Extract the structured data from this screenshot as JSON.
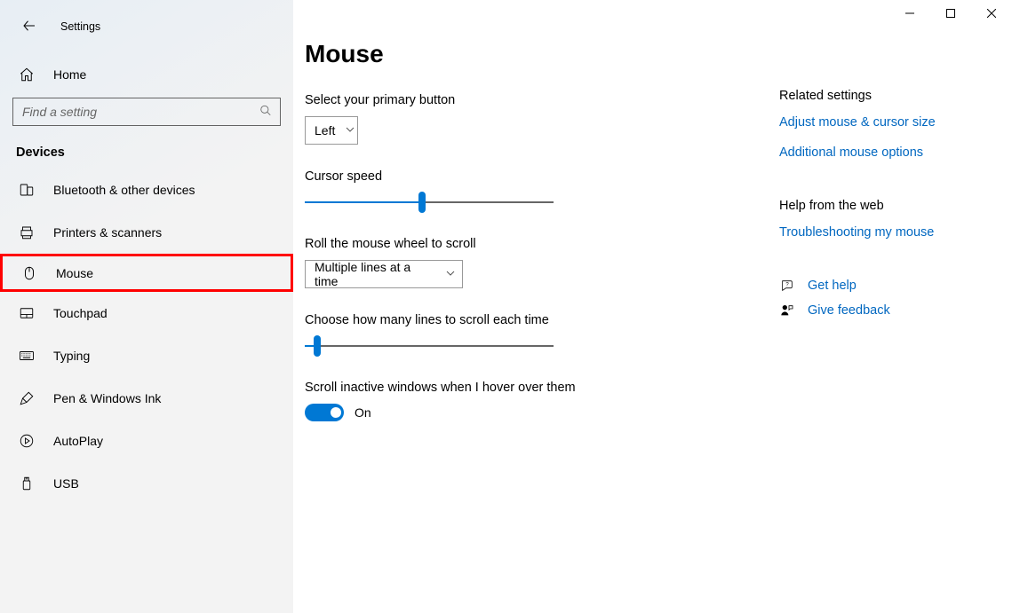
{
  "window": {
    "app_name": "Settings"
  },
  "sidebar": {
    "home_label": "Home",
    "search_placeholder": "Find a setting",
    "category": "Devices",
    "items": [
      {
        "label": "Bluetooth & other devices",
        "icon": "bluetooth-devices-icon"
      },
      {
        "label": "Printers & scanners",
        "icon": "printer-icon"
      },
      {
        "label": "Mouse",
        "icon": "mouse-icon"
      },
      {
        "label": "Touchpad",
        "icon": "touchpad-icon"
      },
      {
        "label": "Typing",
        "icon": "keyboard-icon"
      },
      {
        "label": "Pen & Windows Ink",
        "icon": "pen-icon"
      },
      {
        "label": "AutoPlay",
        "icon": "autoplay-icon"
      },
      {
        "label": "USB",
        "icon": "usb-icon"
      }
    ]
  },
  "main": {
    "title": "Mouse",
    "primary_button": {
      "label": "Select your primary button",
      "value": "Left"
    },
    "cursor_speed": {
      "label": "Cursor speed",
      "value_pct": 47
    },
    "scroll_mode": {
      "label": "Roll the mouse wheel to scroll",
      "value": "Multiple lines at a time"
    },
    "scroll_lines": {
      "label": "Choose how many lines to scroll each time",
      "value_pct": 5
    },
    "inactive_scroll": {
      "label": "Scroll inactive windows when I hover over them",
      "state_label": "On",
      "on": true
    }
  },
  "rail": {
    "related": {
      "heading": "Related settings",
      "links": [
        "Adjust mouse & cursor size",
        "Additional mouse options"
      ]
    },
    "help": {
      "heading": "Help from the web",
      "links": [
        "Troubleshooting my mouse"
      ]
    },
    "actions": {
      "get_help": "Get help",
      "feedback": "Give feedback"
    }
  }
}
